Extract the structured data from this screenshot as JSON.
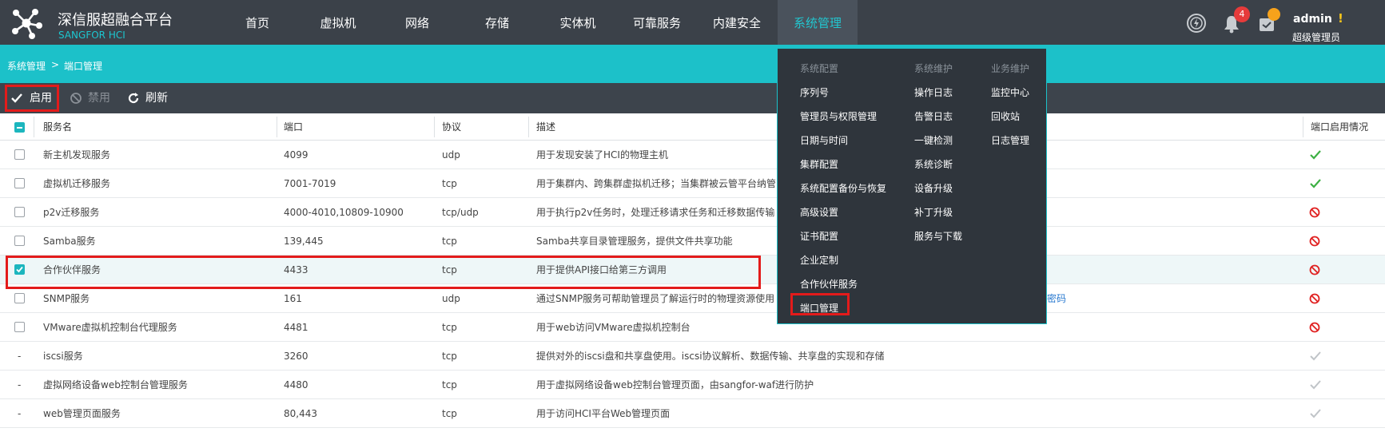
{
  "header": {
    "brand_title": "深信服超融合平台",
    "brand_subtitle": "SANGFOR HCI",
    "nav": [
      "首页",
      "虚拟机",
      "网络",
      "存储",
      "实体机",
      "可靠服务",
      "内建安全",
      "系统管理"
    ],
    "active_nav": "系统管理",
    "notification_count": "4",
    "user_name": "admin",
    "user_warning": "!",
    "user_role": "超级管理员"
  },
  "breadcrumb": {
    "root": "系统管理",
    "separator": ">",
    "current": "端口管理"
  },
  "toolbar": {
    "enable_label": "启用",
    "disable_label": "禁用",
    "refresh_label": "刷新"
  },
  "table": {
    "headers": {
      "name": "服务名",
      "port": "端口",
      "protocol": "协议",
      "description": "描述",
      "status": "端口启用情况"
    },
    "rows": [
      {
        "checkbox": "unchecked",
        "name": "新主机发现服务",
        "port": "4099",
        "protocol": "udp",
        "description": "用于发现安装了HCI的物理主机",
        "status": "enabled"
      },
      {
        "checkbox": "unchecked",
        "name": "虚拟机迁移服务",
        "port": "7001-7019",
        "protocol": "tcp",
        "description": "用于集群内、跨集群虚拟机迁移；当集群被云管平台纳管",
        "status": "enabled"
      },
      {
        "checkbox": "unchecked",
        "name": "p2v迁移服务",
        "port": "4000-4010,10809-10900",
        "protocol": "tcp/udp",
        "description": "用于执行p2v任务时，处理迁移请求任务和迁移数据传输",
        "status": "disabled"
      },
      {
        "checkbox": "unchecked",
        "name": "Samba服务",
        "port": "139,445",
        "protocol": "tcp",
        "description": "Samba共享目录管理服务，提供文件共享功能",
        "status": "disabled"
      },
      {
        "checkbox": "checked",
        "name": "合作伙伴服务",
        "port": "4433",
        "protocol": "tcp",
        "description": "用于提供API接口给第三方调用",
        "status": "disabled"
      },
      {
        "checkbox": "unchecked",
        "name": "SNMP服务",
        "port": "161",
        "protocol": "udp",
        "description": "通过SNMP服务可帮助管理员了解运行时的物理资源使用",
        "status": "disabled",
        "extra_link": "密码"
      },
      {
        "checkbox": "unchecked",
        "name": "VMware虚拟机控制台代理服务",
        "port": "4481",
        "protocol": "tcp",
        "description": "用于web访问VMware虚拟机控制台",
        "status": "disabled"
      },
      {
        "checkbox": "none",
        "name": "iscsi服务",
        "port": "3260",
        "protocol": "tcp",
        "description": "提供对外的iscsi盘和共享盘使用。iscsi协议解析、数据传输、共享盘的实现和存储",
        "status": "locked"
      },
      {
        "checkbox": "none",
        "name": "虚拟网络设备web控制台管理服务",
        "port": "4480",
        "protocol": "tcp",
        "description": "用于虚拟网络设备web控制台管理页面，由sangfor-waf进行防护",
        "status": "locked"
      },
      {
        "checkbox": "none",
        "name": "web管理页面服务",
        "port": "80,443",
        "protocol": "tcp",
        "description": "用于访问HCI平台Web管理页面",
        "status": "locked"
      }
    ],
    "dash": "-"
  },
  "dropdown": {
    "columns": [
      {
        "heading": "系统配置",
        "items": [
          "序列号",
          "管理员与权限管理",
          "日期与时间",
          "集群配置",
          "系统配置备份与恢复",
          "高级设置",
          "证书配置",
          "企业定制",
          "合作伙伴服务",
          "端口管理"
        ]
      },
      {
        "heading": "系统维护",
        "items": [
          "操作日志",
          "告警日志",
          "一键检测",
          "系统诊断",
          "设备升级",
          "补丁升级",
          "服务与下载"
        ]
      },
      {
        "heading": "业务维护",
        "items": [
          "监控中心",
          "回收站",
          "日志管理"
        ]
      }
    ],
    "highlighted_item": "端口管理"
  },
  "colors": {
    "accent": "#1cc1c9",
    "topbar": "#3b4149",
    "toolbar": "#3d444c",
    "enabled": "#3cb043",
    "disabled": "#e02020",
    "locked": "#c0c4c8",
    "highlight_box": "#e31b1b"
  }
}
